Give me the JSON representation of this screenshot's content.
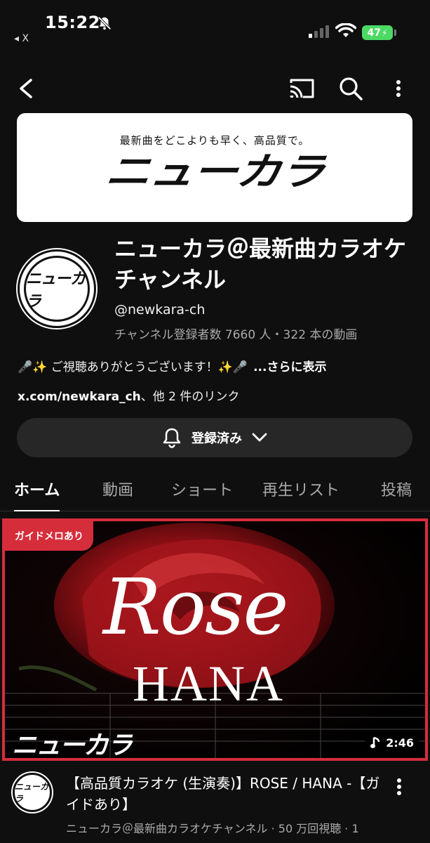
{
  "status_bar": {
    "time": "15:22",
    "back_app": "◂ X",
    "battery": "47"
  },
  "banner": {
    "tagline": "最新曲をどこよりも早く、高品質で。",
    "logo": "ニューカラ"
  },
  "channel": {
    "avatar_logo": "ニューカラ",
    "name": "ニューカラ＠最新曲カラオケチャンネル",
    "handle": "@newkara-ch",
    "stats": "チャンネル登録者数 7660 人・322 本の動画",
    "description": "🎤✨ ご視聴ありがとうございます！✨🎤",
    "description_more": "...さらに表示",
    "link_url": "x.com/newkara_ch",
    "link_rest": "、他 2 件のリンク",
    "subscribe_label": "登録済み"
  },
  "tabs": [
    {
      "label": "ホーム",
      "active": true
    },
    {
      "label": "動画",
      "active": false
    },
    {
      "label": "ショート",
      "active": false
    },
    {
      "label": "再生リスト",
      "active": false
    },
    {
      "label": "投稿",
      "active": false
    }
  ],
  "video": {
    "badge": "ガイドメロあり",
    "thumb_title": "Rose",
    "thumb_artist": "HANA",
    "thumb_logo": "ニューカラ",
    "duration": "2:46",
    "avatar_logo": "ニューカラ",
    "title": "【高品質カラオケ (生演奏)】ROSE / HANA -【ガイドあり】",
    "meta": "ニューカラ＠最新曲カラオケチャンネル · 50 万回視聴 · 1"
  },
  "colors": {
    "background": "#0f0f0f",
    "accent_red": "#d62d3b",
    "button_bg": "#272727",
    "secondary_text": "#aaaaaa",
    "battery_green": "#4cd964"
  },
  "icons": [
    "bell-off-icon",
    "signal-icon",
    "wifi-icon",
    "back-arrow-icon",
    "cast-icon",
    "search-icon",
    "more-vert-icon",
    "bell-icon",
    "chevron-down-icon",
    "music-note-icon"
  ]
}
